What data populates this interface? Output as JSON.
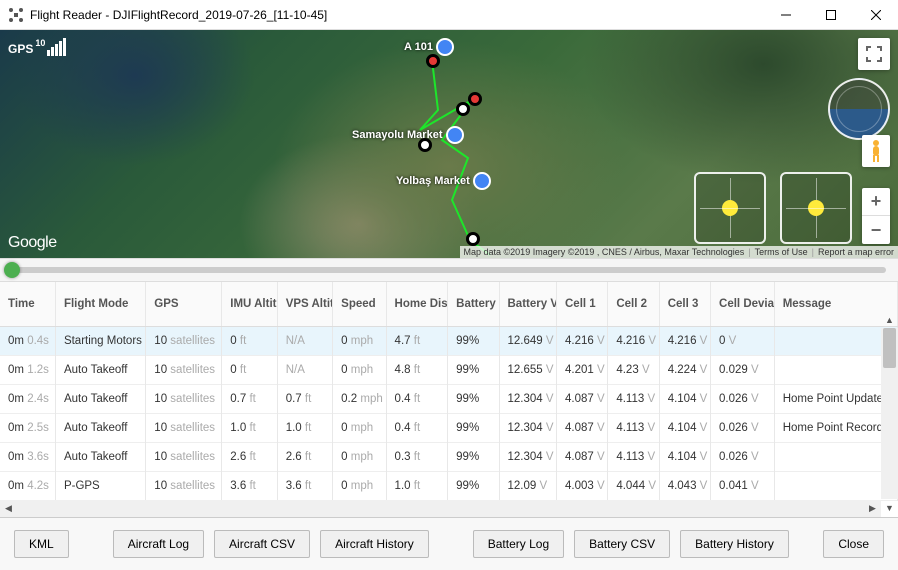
{
  "window": {
    "title": "Flight Reader - DJIFlightRecord_2019-07-26_[11-10-45]"
  },
  "gps": {
    "label": "GPS",
    "count": "10"
  },
  "map": {
    "google": "Google",
    "attribution": "Map data ©2019 Imagery ©2019 , CNES / Airbus, Maxar Technologies",
    "terms": "Terms of Use",
    "report": "Report a map error",
    "labels": {
      "a101": "A 101",
      "samayolu": "Samayolu Market",
      "yolbas": "Yolbaş Market"
    }
  },
  "table": {
    "headers": [
      "Time",
      "Flight Mode",
      "GPS",
      "IMU Altitude",
      "VPS Altitude",
      "Speed",
      "Home Distance",
      "Battery",
      "Battery Voltage",
      "Cell 1",
      "Cell 2",
      "Cell 3",
      "Cell Deviation",
      "Message"
    ],
    "rows": [
      {
        "time_v": "0m",
        "time_u": "0.4s",
        "mode": "Starting Motors",
        "gps_v": "10",
        "gps_u": "satellites",
        "imu_v": "0",
        "imu_u": "ft",
        "vps_v": "",
        "vps_u": "N/A",
        "spd_v": "0",
        "spd_u": "mph",
        "home_v": "4.7",
        "home_u": "ft",
        "bat": "99%",
        "volt_v": "12.649",
        "volt_u": "V",
        "c1_v": "4.216",
        "c1_u": "V",
        "c2_v": "4.216",
        "c2_u": "V",
        "c3_v": "4.216",
        "c3_u": "V",
        "dev_v": "0",
        "dev_u": "V",
        "msg": ""
      },
      {
        "time_v": "0m",
        "time_u": "1.2s",
        "mode": "Auto Takeoff",
        "gps_v": "10",
        "gps_u": "satellites",
        "imu_v": "0",
        "imu_u": "ft",
        "vps_v": "",
        "vps_u": "N/A",
        "spd_v": "0",
        "spd_u": "mph",
        "home_v": "4.8",
        "home_u": "ft",
        "bat": "99%",
        "volt_v": "12.655",
        "volt_u": "V",
        "c1_v": "4.201",
        "c1_u": "V",
        "c2_v": "4.23",
        "c2_u": "V",
        "c3_v": "4.224",
        "c3_u": "V",
        "dev_v": "0.029",
        "dev_u": "V",
        "msg": ""
      },
      {
        "time_v": "0m",
        "time_u": "2.4s",
        "mode": "Auto Takeoff",
        "gps_v": "10",
        "gps_u": "satellites",
        "imu_v": "0.7",
        "imu_u": "ft",
        "vps_v": "0.7",
        "vps_u": "ft",
        "spd_v": "0.2",
        "spd_u": "mph",
        "home_v": "0.4",
        "home_u": "ft",
        "bat": "99%",
        "volt_v": "12.304",
        "volt_u": "V",
        "c1_v": "4.087",
        "c1_u": "V",
        "c2_v": "4.113",
        "c2_u": "V",
        "c3_v": "4.104",
        "c3_u": "V",
        "dev_v": "0.026",
        "dev_u": "V",
        "msg": "Home Point Update"
      },
      {
        "time_v": "0m",
        "time_u": "2.5s",
        "mode": "Auto Takeoff",
        "gps_v": "10",
        "gps_u": "satellites",
        "imu_v": "1.0",
        "imu_u": "ft",
        "vps_v": "1.0",
        "vps_u": "ft",
        "spd_v": "0",
        "spd_u": "mph",
        "home_v": "0.4",
        "home_u": "ft",
        "bat": "99%",
        "volt_v": "12.304",
        "volt_u": "V",
        "c1_v": "4.087",
        "c1_u": "V",
        "c2_v": "4.113",
        "c2_u": "V",
        "c3_v": "4.104",
        "c3_u": "V",
        "dev_v": "0.026",
        "dev_u": "V",
        "msg": "Home Point Recorde"
      },
      {
        "time_v": "0m",
        "time_u": "3.6s",
        "mode": "Auto Takeoff",
        "gps_v": "10",
        "gps_u": "satellites",
        "imu_v": "2.6",
        "imu_u": "ft",
        "vps_v": "2.6",
        "vps_u": "ft",
        "spd_v": "0",
        "spd_u": "mph",
        "home_v": "0.3",
        "home_u": "ft",
        "bat": "99%",
        "volt_v": "12.304",
        "volt_u": "V",
        "c1_v": "4.087",
        "c1_u": "V",
        "c2_v": "4.113",
        "c2_u": "V",
        "c3_v": "4.104",
        "c3_u": "V",
        "dev_v": "0.026",
        "dev_u": "V",
        "msg": ""
      },
      {
        "time_v": "0m",
        "time_u": "4.2s",
        "mode": "P-GPS",
        "gps_v": "10",
        "gps_u": "satellites",
        "imu_v": "3.6",
        "imu_u": "ft",
        "vps_v": "3.6",
        "vps_u": "ft",
        "spd_v": "0",
        "spd_u": "mph",
        "home_v": "1.0",
        "home_u": "ft",
        "bat": "99%",
        "volt_v": "12.09",
        "volt_u": "V",
        "c1_v": "4.003",
        "c1_u": "V",
        "c2_v": "4.044",
        "c2_u": "V",
        "c3_v": "4.043",
        "c3_u": "V",
        "dev_v": "0.041",
        "dev_u": "V",
        "msg": ""
      }
    ]
  },
  "buttons": {
    "kml": "KML",
    "aircraft_log": "Aircraft Log",
    "aircraft_csv": "Aircraft CSV",
    "aircraft_history": "Aircraft History",
    "battery_log": "Battery Log",
    "battery_csv": "Battery CSV",
    "battery_history": "Battery History",
    "close": "Close"
  }
}
